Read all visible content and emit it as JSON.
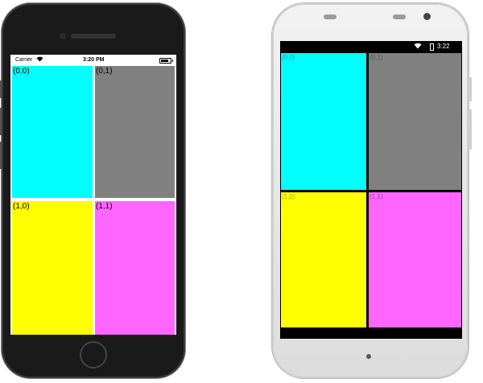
{
  "ios": {
    "status": {
      "carrier": "Carrier",
      "time": "3:20 PM"
    },
    "cells": [
      {
        "label": "(0,0)",
        "color": "#00FFFF"
      },
      {
        "label": "(0,1)",
        "color": "#808080"
      },
      {
        "label": "(1,0)",
        "color": "#FFFF00"
      },
      {
        "label": "(1,1)",
        "color": "#FF66FF"
      }
    ]
  },
  "android": {
    "status": {
      "time": "3:22"
    },
    "cells": [
      {
        "label": "(0,0)",
        "color": "#00FFFF"
      },
      {
        "label": "(0,1)",
        "color": "#808080"
      },
      {
        "label": "(1,0)",
        "color": "#FFFF00"
      },
      {
        "label": "(1,1)",
        "color": "#FF66FF"
      }
    ]
  }
}
